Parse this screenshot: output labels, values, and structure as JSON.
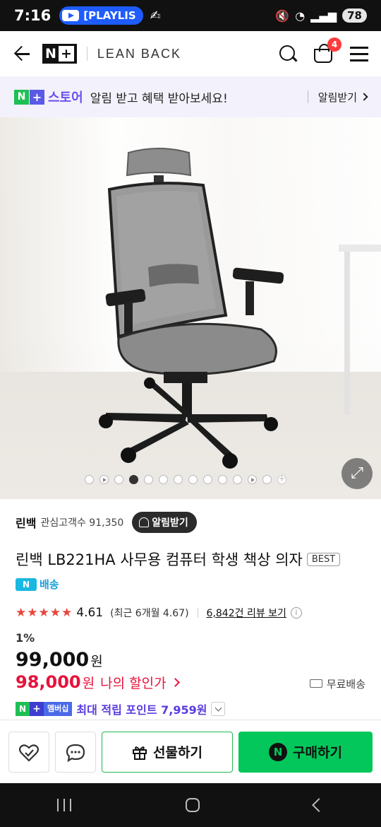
{
  "status_bar": {
    "time": "7:16",
    "playlist_label": "[PLAYLIS",
    "battery": "78"
  },
  "header": {
    "back_icon": "arrow-left",
    "service_logo": "N+",
    "brand_logo": "LEAN BACK",
    "cart_count": "4"
  },
  "store_banner": {
    "store_label": "스토어",
    "message": "알림 받고 혜택 받아보세요!",
    "link_label": "알림받기"
  },
  "product": {
    "image_alt": "grey mesh office chair",
    "slide_count": 14,
    "active_slide": 4,
    "seller": {
      "name": "린백",
      "fans_label": "관심고객수 91,350",
      "alarm_button": "알림받기"
    },
    "title": "린백 LB221HA 사무용 컴퓨터 학생 책상 의자",
    "badge": "BEST",
    "delivery_icon": "N",
    "delivery_label": "배송",
    "rating": "4.61",
    "rating_value": 4.61,
    "recent_rating": "(최근 6개월 4.67)",
    "reviews_link": "6,842건 리뷰 보기",
    "discount_rate": "1%",
    "original_price": "99,000",
    "currency": "원",
    "sale_price": "98,000",
    "my_discount_label": "나의 할인가",
    "free_shipping": "무료배송",
    "membership_label": "멤버십",
    "points_label": "최대 적립 포인트 7,959원"
  },
  "actions": {
    "gift_label": "선물하기",
    "buy_label": "구매하기"
  },
  "colors": {
    "npay_green": "#03c75a",
    "sale_red": "#e8123c",
    "points_purple": "#5b3be0",
    "store_purple": "#6b4ef0"
  }
}
